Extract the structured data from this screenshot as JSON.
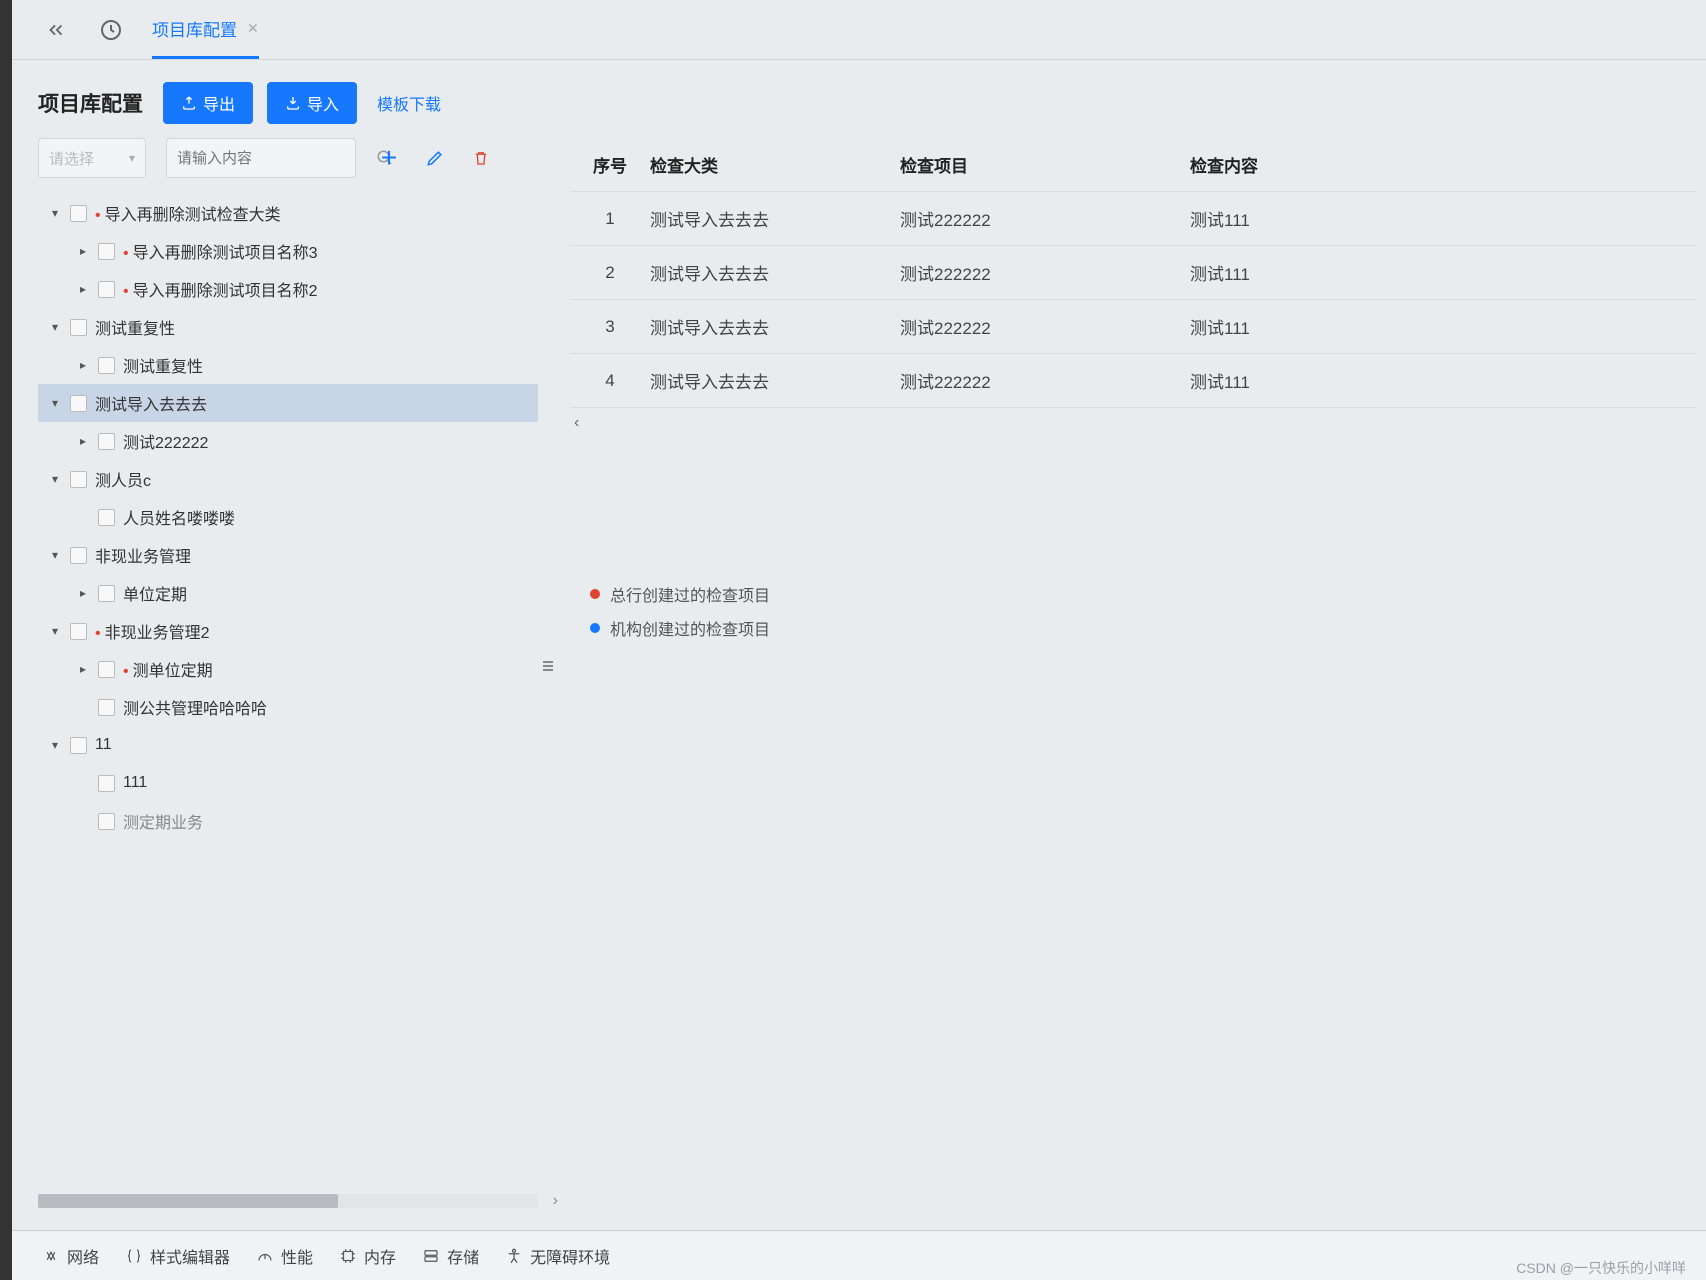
{
  "tab": {
    "label": "项目库配置"
  },
  "header": {
    "title": "项目库配置",
    "export_label": "导出",
    "import_label": "导入",
    "template_link": "模板下载"
  },
  "filter": {
    "select_placeholder": "请选择",
    "search_placeholder": "请输入内容"
  },
  "tree": [
    {
      "level": 0,
      "toggle": "▾",
      "label": "导入再删除测试检查大类",
      "red": true
    },
    {
      "level": 1,
      "toggle": "▸",
      "label": "导入再删除测试项目名称3",
      "red": true
    },
    {
      "level": 1,
      "toggle": "▸",
      "label": "导入再删除测试项目名称2",
      "red": true
    },
    {
      "level": 0,
      "toggle": "▾",
      "label": "测试重复性"
    },
    {
      "level": 1,
      "toggle": "▸",
      "label": "测试重复性"
    },
    {
      "level": 0,
      "toggle": "▾",
      "label": "测试导入去去去",
      "selected": true
    },
    {
      "level": 1,
      "toggle": "▸",
      "label": "测试222222"
    },
    {
      "level": 0,
      "toggle": "▾",
      "label": "测人员c"
    },
    {
      "level": 1,
      "toggle": "",
      "label": "人员姓名喽喽喽"
    },
    {
      "level": 0,
      "toggle": "▾",
      "label": "非现业务管理"
    },
    {
      "level": 1,
      "toggle": "▸",
      "label": "单位定期"
    },
    {
      "level": 0,
      "toggle": "▾",
      "label": "非现业务管理2",
      "red": true
    },
    {
      "level": 1,
      "toggle": "▸",
      "label": "测单位定期",
      "red": true
    },
    {
      "level": 1,
      "toggle": "",
      "label": "测公共管理哈哈哈哈"
    },
    {
      "level": 0,
      "toggle": "▾",
      "label": "11"
    },
    {
      "level": 1,
      "toggle": "",
      "label": "111"
    },
    {
      "level": 1,
      "toggle": "",
      "label": "测定期业务",
      "truncated": true
    }
  ],
  "table": {
    "columns": [
      "序号",
      "检查大类",
      "检查项目",
      "检查内容"
    ],
    "rows": [
      {
        "index": "1",
        "category": "测试导入去去去",
        "item": "测试222222",
        "content": "测试111"
      },
      {
        "index": "2",
        "category": "测试导入去去去",
        "item": "测试222222",
        "content": "测试111"
      },
      {
        "index": "3",
        "category": "测试导入去去去",
        "item": "测试222222",
        "content": "测试111"
      },
      {
        "index": "4",
        "category": "测试导入去去去",
        "item": "测试222222",
        "content": "测试111"
      }
    ]
  },
  "legend": {
    "red": "总行创建过的检查项目",
    "blue": "机构创建过的检查项目"
  },
  "devtools": {
    "network": "网络",
    "style_editor": "样式编辑器",
    "performance": "性能",
    "memory": "内存",
    "storage": "存储",
    "accessibility": "无障碍环境"
  },
  "watermark": "CSDN @一只快乐的小咩咩"
}
